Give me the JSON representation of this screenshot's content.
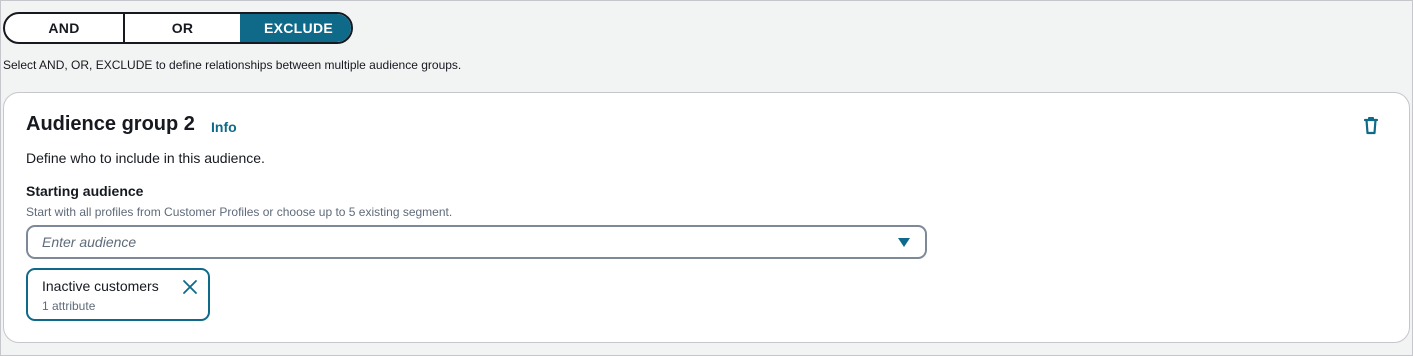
{
  "operator_toggle": {
    "options": [
      {
        "label": "AND",
        "active": false
      },
      {
        "label": "OR",
        "active": false
      },
      {
        "label": "EXCLUDE",
        "active": true
      }
    ],
    "helper_text": "Select AND, OR, EXCLUDE to define relationships between multiple audience groups."
  },
  "audience_group": {
    "title": "Audience group 2",
    "info_link": "Info",
    "description": "Define who to include in this audience.",
    "delete_icon": "trash-icon",
    "starting_audience": {
      "label": "Starting audience",
      "description": "Start with all profiles from Customer Profiles or choose up to 5 existing segment.",
      "placeholder": "Enter audience",
      "dropdown_icon": "caret-down-icon"
    },
    "selected_tokens": [
      {
        "label": "Inactive customers",
        "sublabel": "1 attribute",
        "remove_icon": "close-icon"
      }
    ]
  },
  "colors": {
    "accent": "#0f6a8a",
    "text": "#16191f",
    "secondary_text": "#5f6b7a",
    "page_background": "#f2f3f3",
    "card_border": "#c6c6cd"
  }
}
